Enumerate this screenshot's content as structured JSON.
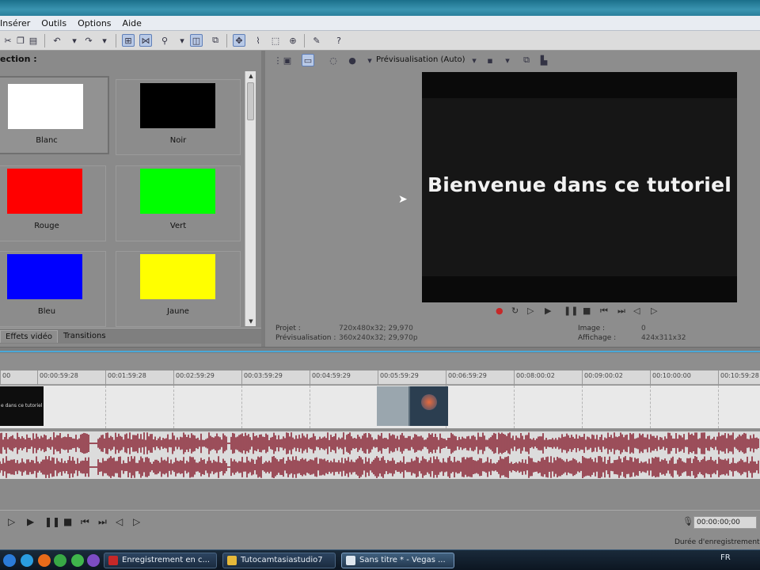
{
  "menu": [
    "Insérer",
    "Outils",
    "Options",
    "Aide"
  ],
  "left_panel": {
    "title": "ection :",
    "swatches": [
      {
        "label": "Blanc",
        "color": "#ffffff"
      },
      {
        "label": "Noir",
        "color": "#000000"
      },
      {
        "label": "Rouge",
        "color": "#ff0000"
      },
      {
        "label": "Vert",
        "color": "#00ff00"
      },
      {
        "label": "Bleu",
        "color": "#0000ff"
      },
      {
        "label": "Jaune",
        "color": "#ffff00"
      }
    ],
    "tabs": [
      "Effets vidéo",
      "Transitions"
    ]
  },
  "preview": {
    "mode_label": "Prévisualisation (Auto)",
    "canvas_text": "Bienvenue dans ce tutoriel",
    "info": {
      "projet_label": "Projet :",
      "projet_value": "720x480x32; 29,970",
      "previsualisation_label": "Prévisualisation :",
      "previsualisation_value": "360x240x32; 29,970p",
      "image_label": "Image :",
      "image_value": "0",
      "affichage_label": "Affichage :",
      "affichage_value": "424x311x32"
    }
  },
  "timeline": {
    "ruler_start": "00",
    "ticks": [
      "00:00:59:28",
      "00:01:59:28",
      "00:02:59:29",
      "00:03:59:29",
      "00:04:59:29",
      "00:05:59:29",
      "00:06:59:29",
      "00:08:00:02",
      "00:09:00:02",
      "00:10:00:00",
      "00:10:59:28"
    ],
    "clip1_text": "e dans ce tutoriel"
  },
  "status": {
    "time": "00:00:00;00",
    "duree": "Durée d'enregistrement"
  },
  "taskbar": {
    "tasks": [
      "Enregistrement en c...",
      "Tutocamtasiastudio7",
      "Sans titre * - Vegas ..."
    ],
    "lang": "FR"
  },
  "colors": {
    "waveform": "#8b2b3a",
    "accent": "#4aa8d8"
  }
}
